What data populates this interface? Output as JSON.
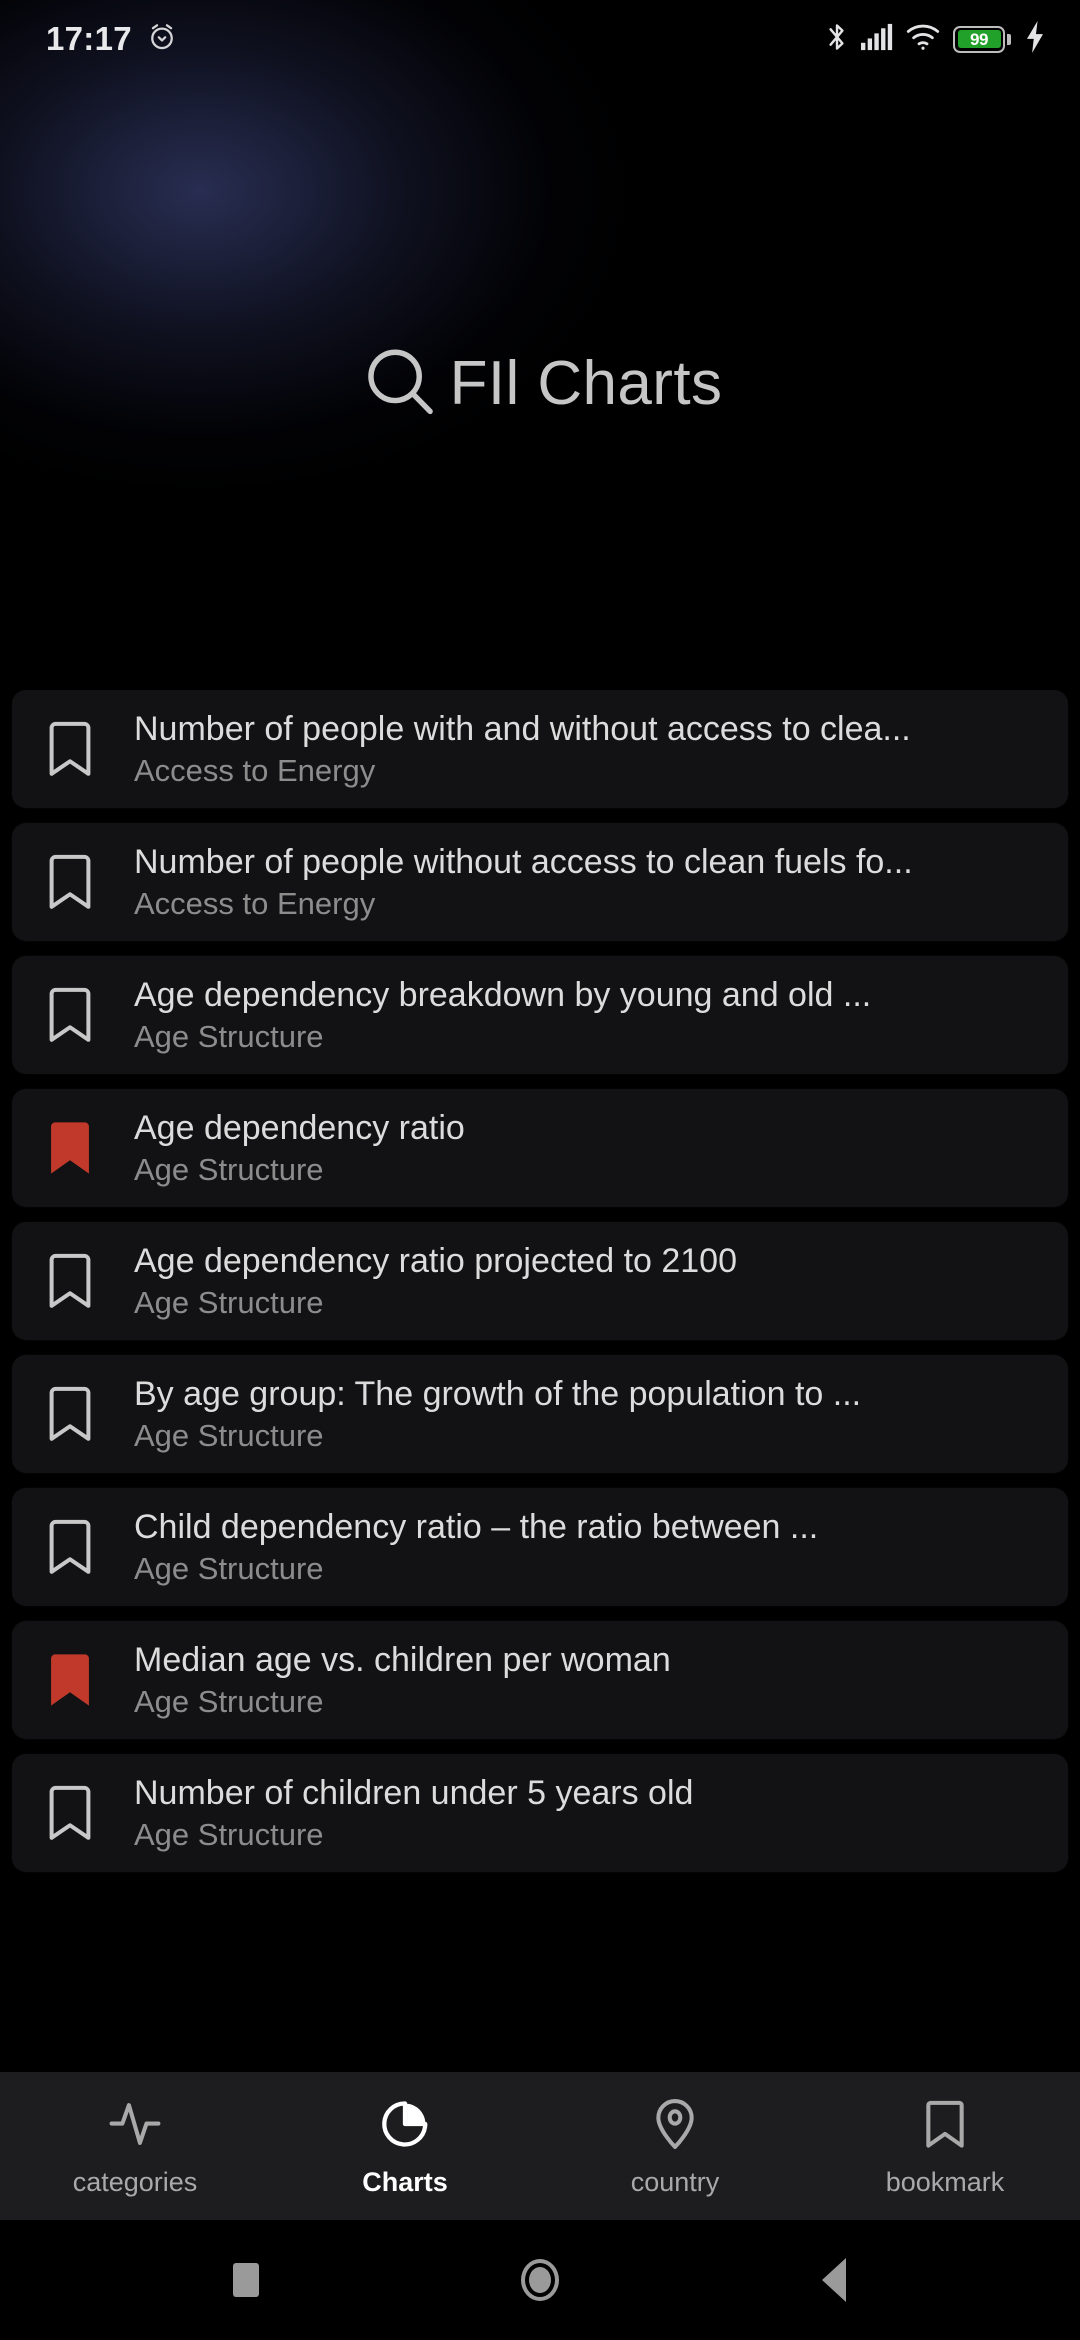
{
  "status_bar": {
    "time": "17:17",
    "alarm_icon": "alarm-clock-icon",
    "bluetooth_icon": "bluetooth-icon",
    "signal_icon": "cellular-signal-icon",
    "wifi_icon": "wifi-icon",
    "battery_percent": "99",
    "charging_icon": "charging-bolt-icon",
    "battery_color": "#22a12a"
  },
  "header": {
    "search_icon": "search-icon",
    "title": "FIl Charts"
  },
  "theme": {
    "background": "#000000",
    "card_background": "#121214",
    "bookmark_active_color": "#c0392b",
    "bookmark_inactive_color": "#c8c8c8",
    "title_text_color": "#dcdcdc",
    "subtitle_text_color": "#8c8c8c",
    "nav_background": "#1d1d1f"
  },
  "list": {
    "items": [
      {
        "title": "Number of people with and without access to clea...",
        "subtitle": "Access to Energy",
        "bookmarked": false
      },
      {
        "title": "Number of people without access to clean fuels fo...",
        "subtitle": "Access to Energy",
        "bookmarked": false
      },
      {
        "title": "Age dependency breakdown by young and old ...",
        "subtitle": "Age Structure",
        "bookmarked": false
      },
      {
        "title": "Age dependency ratio",
        "subtitle": "Age Structure",
        "bookmarked": true
      },
      {
        "title": "Age dependency ratio projected to 2100",
        "subtitle": "Age Structure",
        "bookmarked": false
      },
      {
        "title": "By age group: The growth of the population to ...",
        "subtitle": "Age Structure",
        "bookmarked": false
      },
      {
        "title": "Child dependency ratio – the ratio between ...",
        "subtitle": "Age Structure",
        "bookmarked": false
      },
      {
        "title": "Median age vs. children per woman",
        "subtitle": "Age Structure",
        "bookmarked": true
      },
      {
        "title": "Number of children under 5 years old",
        "subtitle": "Age Structure",
        "bookmarked": false
      }
    ]
  },
  "bottom_nav": {
    "items": [
      {
        "label": "categories",
        "icon": "activity-pulse-icon",
        "active": false
      },
      {
        "label": "Charts",
        "icon": "pie-chart-icon",
        "active": true
      },
      {
        "label": "country",
        "icon": "location-pin-icon",
        "active": false
      },
      {
        "label": "bookmark",
        "icon": "bookmark-icon",
        "active": false
      }
    ]
  },
  "system_nav": {
    "recents": "recents-square-icon",
    "home": "home-circle-icon",
    "back": "back-triangle-icon"
  }
}
